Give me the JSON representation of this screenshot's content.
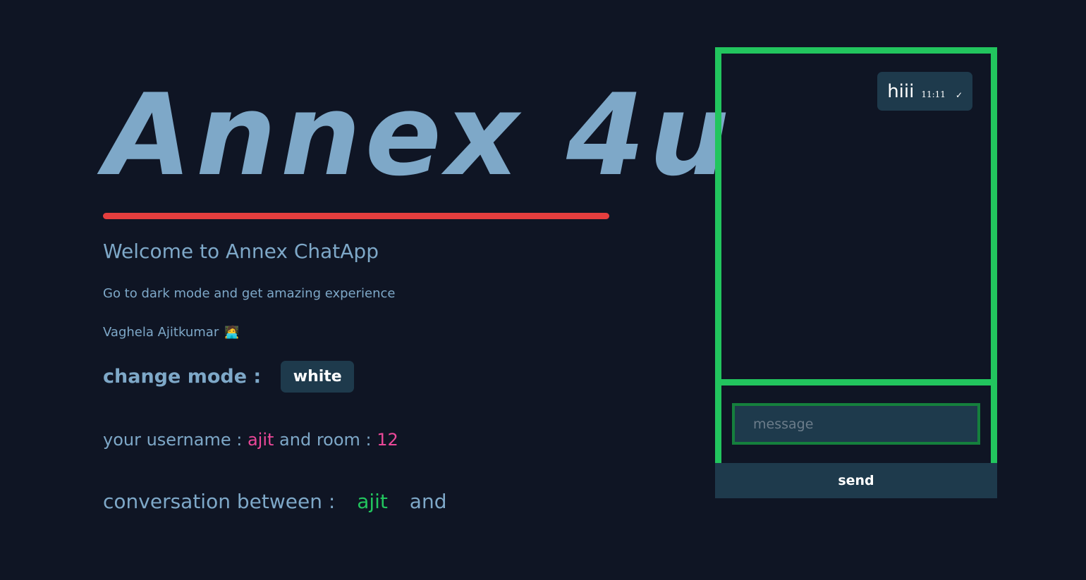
{
  "header": {
    "title": "Annex 4u",
    "welcome": "Welcome to Annex ChatApp",
    "tagline": "Go to dark mode and get amazing experience",
    "author": "Vaghela Ajitkumar",
    "author_icon": "🧑‍💻"
  },
  "mode": {
    "label": "change mode :",
    "button_label": "white"
  },
  "session": {
    "username_label": "your username :",
    "username": "ajit",
    "room_label": "and room :",
    "room": "12"
  },
  "conversation": {
    "label": "conversation between :",
    "user": "ajit",
    "and_label": "and"
  },
  "chat": {
    "messages": [
      {
        "text": "hiii",
        "time": "11:11",
        "status_icon": "✓"
      }
    ],
    "input_placeholder": "message",
    "input_value": "",
    "send_label": "send"
  },
  "colors": {
    "background": "#0f1524",
    "text": "#7ea8c8",
    "underline": "#e53e3e",
    "panel_border": "#22c55e",
    "username_accent": "#ec4899",
    "conversation_accent": "#22c55e",
    "control_bg": "#1e3a4c"
  }
}
